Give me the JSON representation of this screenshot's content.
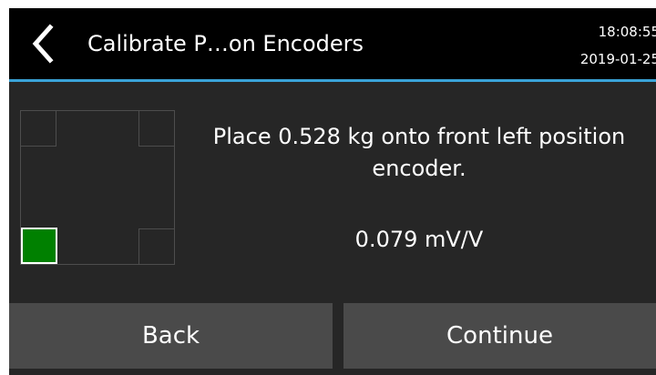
{
  "header": {
    "title": "Calibrate P…on Encoders",
    "time": "18:08:55",
    "date": "2019-01-25",
    "back_icon": "chevron-left-icon",
    "rule_color": "#3aa3d8"
  },
  "encoder_map": {
    "active_position": "front left",
    "active_color": "#008000",
    "positions": [
      "rear left",
      "rear right",
      "front left",
      "front right"
    ]
  },
  "main": {
    "instruction": "Place 0.528 kg onto front left position encoder.",
    "reading": "0.079 mV/V"
  },
  "footer": {
    "back_label": "Back",
    "continue_label": "Continue"
  }
}
